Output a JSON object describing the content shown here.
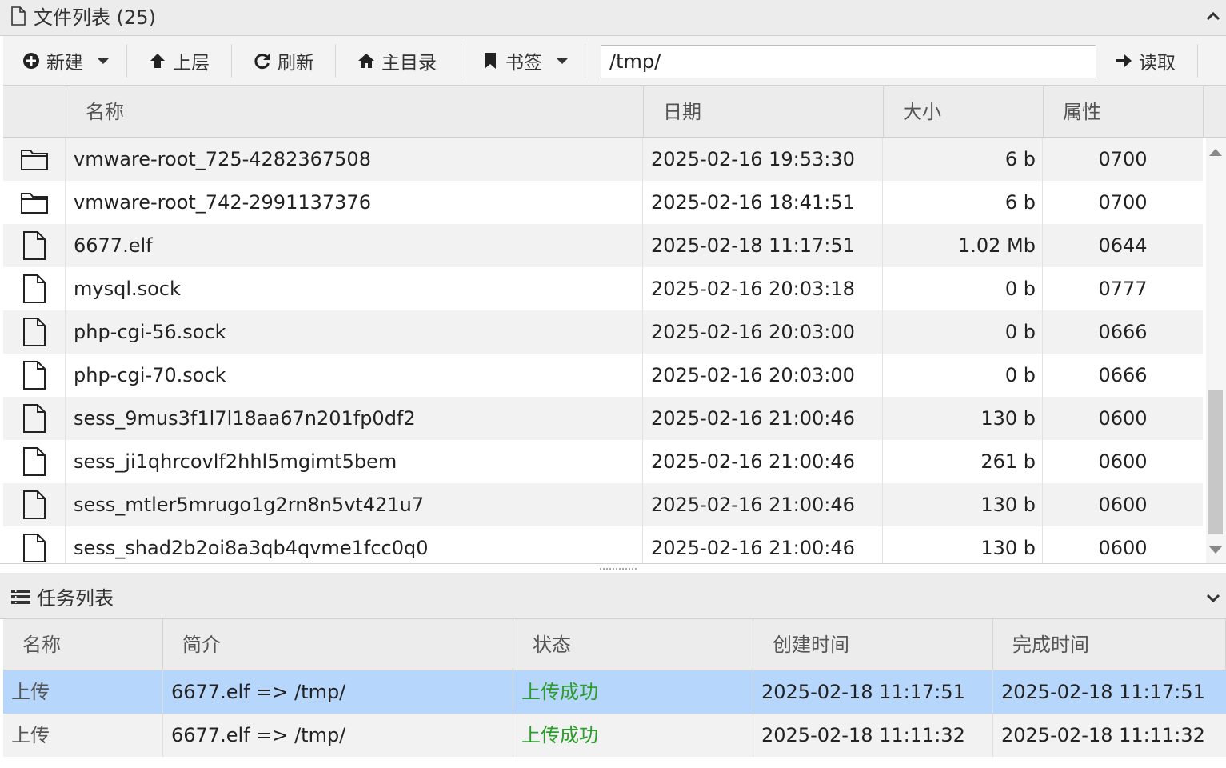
{
  "file_panel": {
    "title": "文件列表 (25)",
    "toolbar": {
      "new_label": "新建",
      "up_label": "上层",
      "refresh_label": "刷新",
      "home_label": "主目录",
      "bookmark_label": "书签",
      "path_value": "/tmp/",
      "read_label": "读取"
    },
    "columns": [
      "名称",
      "日期",
      "大小",
      "属性"
    ],
    "rows": [
      {
        "type": "folder",
        "name": "vmware-root_725-4282367508",
        "date": "2025-02-16 19:53:30",
        "size": "6 b",
        "attr": "0700"
      },
      {
        "type": "folder",
        "name": "vmware-root_742-2991137376",
        "date": "2025-02-16 18:41:51",
        "size": "6 b",
        "attr": "0700"
      },
      {
        "type": "file",
        "name": "6677.elf",
        "date": "2025-02-18 11:17:51",
        "size": "1.02 Mb",
        "attr": "0644"
      },
      {
        "type": "file",
        "name": "mysql.sock",
        "date": "2025-02-16 20:03:18",
        "size": "0 b",
        "attr": "0777"
      },
      {
        "type": "file",
        "name": "php-cgi-56.sock",
        "date": "2025-02-16 20:03:00",
        "size": "0 b",
        "attr": "0666"
      },
      {
        "type": "file",
        "name": "php-cgi-70.sock",
        "date": "2025-02-16 20:03:00",
        "size": "0 b",
        "attr": "0666"
      },
      {
        "type": "file",
        "name": "sess_9mus3f1l7l18aa67n201fp0df2",
        "date": "2025-02-16 21:00:46",
        "size": "130 b",
        "attr": "0600"
      },
      {
        "type": "file",
        "name": "sess_ji1qhrcovlf2hhl5mgimt5bem",
        "date": "2025-02-16 21:00:46",
        "size": "261 b",
        "attr": "0600"
      },
      {
        "type": "file",
        "name": "sess_mtler5mrugo1g2rn8n5vt421u7",
        "date": "2025-02-16 21:00:46",
        "size": "130 b",
        "attr": "0600"
      },
      {
        "type": "file",
        "name": "sess_shad2b2oi8a3qb4qvme1fcc0q0",
        "date": "2025-02-16 21:00:46",
        "size": "130 b",
        "attr": "0600"
      }
    ]
  },
  "task_panel": {
    "title": "任务列表",
    "columns": [
      "名称",
      "简介",
      "状态",
      "创建时间",
      "完成时间"
    ],
    "rows": [
      {
        "name": "上传",
        "desc": "6677.elf => /tmp/",
        "status": "上传成功",
        "created": "2025-02-18 11:17:51",
        "finished": "2025-02-18 11:17:51"
      },
      {
        "name": "上传",
        "desc": "6677.elf => /tmp/",
        "status": "上传成功",
        "created": "2025-02-18 11:11:32",
        "finished": "2025-02-18 11:11:32"
      }
    ]
  },
  "icons": {
    "file_panel_title": "file-icon",
    "new": "plus-circle-icon",
    "up": "arrow-up-icon",
    "refresh": "refresh-icon",
    "home": "home-icon",
    "bookmark": "bookmark-icon",
    "read": "arrow-right-icon",
    "task_panel_title": "list-icon"
  },
  "colors": {
    "selected_row": "#b7d6fb",
    "status_success": "#2a9d2a",
    "header_bg": "#ececec"
  }
}
